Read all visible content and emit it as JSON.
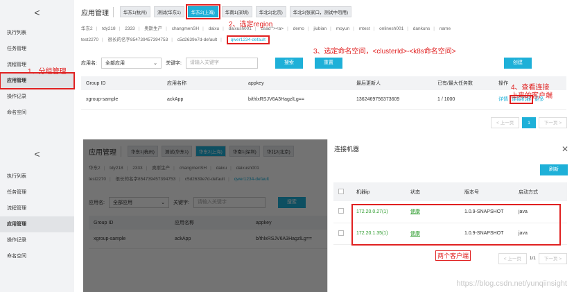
{
  "sidebar": {
    "back": "<",
    "items": [
      "执行列表",
      "任务管理",
      "流程管理",
      "应用管理",
      "操作记录",
      "命名空间"
    ]
  },
  "header": {
    "title": "应用管理",
    "regions": [
      "华东1(杭州)",
      "测试(华东1)",
      "华东2(上海)",
      "华南1(深圳)",
      "华北2(北京)",
      "华北3(张家口，测试中勿用)"
    ]
  },
  "namespaces": {
    "row1": [
      "华东2",
      "tdy218",
      "2333",
      "奥斯生产",
      "changmenSH",
      "daixu",
      "daixush001",
      "dsad\"'><a>",
      "demo",
      "jiubian",
      "moyun",
      "mtest",
      "onlinesh001",
      "dankuns",
      "name"
    ],
    "row2": [
      "test2270",
      "很长的名字854739457394753",
      "c5d2639e7d-default",
      "qwer1234-default"
    ]
  },
  "filter": {
    "app_label": "应用名:",
    "app_value": "全部应用",
    "kw_label": "关键字:",
    "kw_placeholder": "请输入关键字",
    "search": "搜索",
    "reset": "重置",
    "create": "创建"
  },
  "table": {
    "headers": [
      "Group ID",
      "应用名称",
      "appkey",
      "最后更新人",
      "已有/最大任务数",
      "操作"
    ],
    "row": {
      "group_id": "xgroup-sample",
      "app_name": "ackApp",
      "appkey": "b/thlxRSJV6A3HagzlLg==",
      "updater": "1362469756373609",
      "tasks": "1 / 1000",
      "act_detail": "详情",
      "act_connect": "连接机器",
      "act_more": "更多"
    }
  },
  "pager": {
    "prev": "< 上一页",
    "page": "1",
    "next": "下一页 >",
    "page_of": "1/1"
  },
  "notes": {
    "n1": "1、分组管理",
    "n2": "2、选定region",
    "n3": "3、选定命名空间，<clusterId>-<k8s命名空间>",
    "n4a": "4、查看连接",
    "n4b": "上来的客户端",
    "n5": "两个客户端"
  },
  "dialog": {
    "title": "连接机器",
    "refresh": "刷新",
    "headers": [
      "机器ip",
      "状态",
      "版本号",
      "启动方式"
    ],
    "rows": [
      {
        "ip": "172.20.0.27(1)",
        "status": "健康",
        "version": "1.0.9-SNAPSHOT",
        "mode": "java"
      },
      {
        "ip": "172.20.1.35(1)",
        "status": "健康",
        "version": "1.0.9-SNAPSHOT",
        "mode": "java"
      }
    ]
  },
  "watermark": "https://blog.csdn.net/yunqiinsight"
}
